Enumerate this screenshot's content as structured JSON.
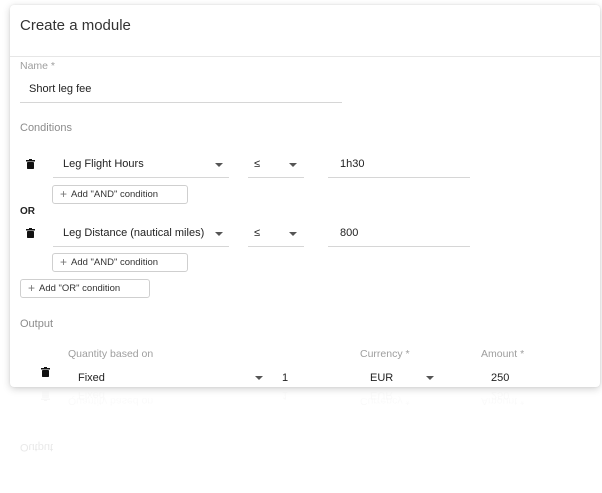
{
  "modal": {
    "title": "Create a module"
  },
  "name_field": {
    "label": "Name *",
    "value": "Short leg fee"
  },
  "conditions": {
    "section_label": "Conditions",
    "or_label": "OR",
    "rows": [
      {
        "field": "Leg Flight Hours",
        "operator": "≤",
        "value": "1h30",
        "add_and_label": "Add \"AND\" condition"
      },
      {
        "field": "Leg Distance (nautical miles)",
        "operator": "≤",
        "value": "800",
        "add_and_label": "Add \"AND\" condition"
      }
    ],
    "add_or_label": "Add \"OR\" condition"
  },
  "output": {
    "section_label": "Output",
    "headers": {
      "quantity": "Quantity based on",
      "currency": "Currency *",
      "amount": "Amount *"
    },
    "row": {
      "quantity_based_on": "Fixed",
      "quantity": "1",
      "currency": "EUR",
      "amount": "250"
    }
  },
  "icons": {
    "trash": "trash-icon",
    "caret": "chevron-down-icon",
    "plus": "plus-icon"
  }
}
